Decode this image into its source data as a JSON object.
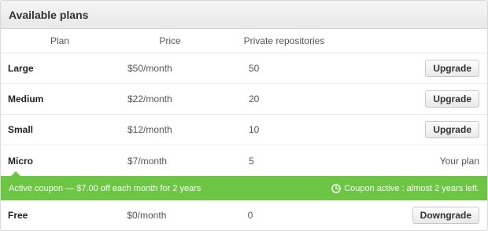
{
  "header": {
    "title": "Available plans"
  },
  "columns": {
    "plan": "Plan",
    "price": "Price",
    "repos": "Private repositories"
  },
  "plans": [
    {
      "name": "Large",
      "price": "$50/month",
      "repos": "50",
      "action": "Upgrade"
    },
    {
      "name": "Medium",
      "price": "$22/month",
      "repos": "20",
      "action": "Upgrade"
    },
    {
      "name": "Small",
      "price": "$12/month",
      "repos": "10",
      "action": "Upgrade"
    },
    {
      "name": "Micro",
      "price": "$7/month",
      "repos": "5",
      "status": "Your plan"
    },
    {
      "name": "Free",
      "price": "$0/month",
      "repos": "0",
      "action": "Downgrade"
    }
  ],
  "coupon": {
    "message": "Active coupon — $7.00 off each month for 2 years",
    "status": "Coupon active : almost 2 years left.",
    "icon": "clock-icon"
  },
  "colors": {
    "coupon_bg": "#6cc644",
    "header_bg": "#eeeeee"
  }
}
